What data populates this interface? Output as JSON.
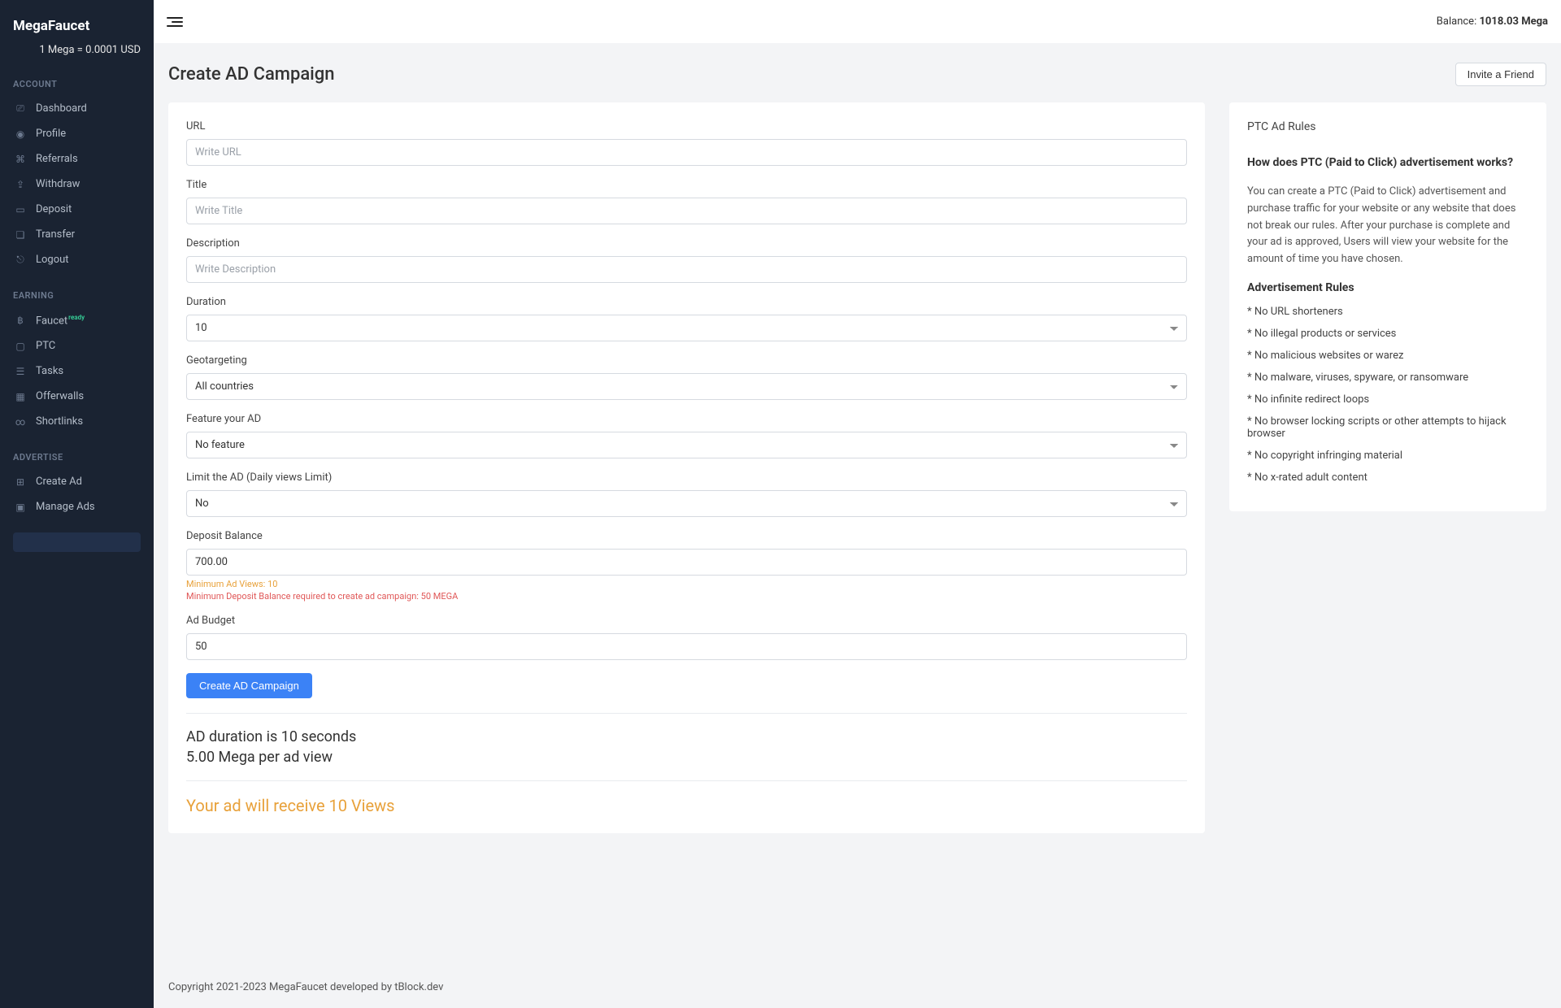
{
  "brand": "MegaFaucet",
  "rate": "1 Mega = 0.0001 USD",
  "sidebar": {
    "account_heading": "ACCOUNT",
    "earning_heading": "EARNING",
    "advertise_heading": "ADVERTISE",
    "dashboard": "Dashboard",
    "profile": "Profile",
    "referrals": "Referrals",
    "withdraw": "Withdraw",
    "deposit": "Deposit",
    "transfer": "Transfer",
    "logout": "Logout",
    "faucet": "Faucet",
    "faucet_badge": "ready",
    "ptc": "PTC",
    "tasks": "Tasks",
    "offerwalls": "Offerwalls",
    "shortlinks": "Shortlinks",
    "create_ad": "Create Ad",
    "manage_ads": "Manage Ads"
  },
  "topbar": {
    "balance_label": "Balance: ",
    "balance_value": "1018.03 Mega"
  },
  "page": {
    "title": "Create AD Campaign",
    "invite_label": "Invite a Friend"
  },
  "form": {
    "url_label": "URL",
    "url_placeholder": "Write URL",
    "title_label": "Title",
    "title_placeholder": "Write Title",
    "description_label": "Description",
    "description_placeholder": "Write Description",
    "duration_label": "Duration",
    "duration_value": "10",
    "geo_label": "Geotargeting",
    "geo_value": "All countries",
    "feature_label": "Feature your AD",
    "feature_value": "No feature",
    "limit_label": "Limit the AD (Daily views Limit)",
    "limit_value": "No",
    "deposit_label": "Deposit Balance",
    "deposit_value": "700.00",
    "hint_min_views": "Minimum Ad Views: 10",
    "hint_min_deposit": "Minimum Deposit Balance required to create ad campaign: 50 MEGA",
    "budget_label": "Ad Budget",
    "budget_value": "50",
    "submit_label": "Create AD Campaign",
    "summary_duration": "AD duration is 10 seconds",
    "summary_rate": "5.00 Mega per ad view",
    "summary_views": "Your ad will receive 10 Views"
  },
  "rules": {
    "heading": "PTC Ad Rules",
    "question": "How does PTC (Paid to Click) advertisement works?",
    "paragraph": "You can create a PTC (Paid to Click) advertisement and purchase traffic for your website or any website that does not break our rules. After your purchase is complete and your ad is approved, Users will view your website for the amount of time you have chosen.",
    "subtitle": "Advertisement Rules",
    "r1": "* No URL shorteners",
    "r2": "* No illegal products or services",
    "r3": "* No malicious websites or warez",
    "r4": "* No malware, viruses, spyware, or ransomware",
    "r5": "* No infinite redirect loops",
    "r6": "* No browser locking scripts or other attempts to hijack browser",
    "r7": "* No copyright infringing material",
    "r8": "* No x-rated adult content"
  },
  "footer": "Copyright 2021-2023 MegaFaucet developed by tBlock.dev"
}
